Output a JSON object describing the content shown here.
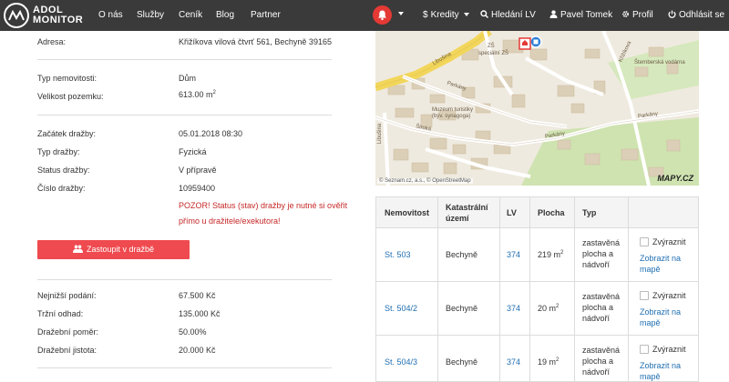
{
  "navbar": {
    "logo_line1": "ADOL",
    "logo_line2": "MONITOR",
    "links": [
      "O nás",
      "Služby",
      "Ceník",
      "Blog",
      "Partner"
    ],
    "credits": "Kredity",
    "search_lv": "Hledání LV",
    "user": "Pavel Tomek",
    "profile": "Profil",
    "logout": "Odhlásit se"
  },
  "property": {
    "address_label": "Adresa:",
    "address_value": "Křižíkova vilová čtvrť 561, Bechyně 39165",
    "type_label": "Typ nemovitosti:",
    "type_value": "Dům",
    "size_label": "Velikost pozemku:",
    "size_value": "613.00 m",
    "size_unit_sup": "2"
  },
  "auction": {
    "start_label": "Začátek dražby:",
    "start_value": "05.01.2018 08:30",
    "type_label": "Typ dražby:",
    "type_value": "Fyzická",
    "status_label": "Status dražby:",
    "status_value": "V přípravě",
    "number_label": "Číslo dražby:",
    "number_value": "10959400",
    "warning": "POZOR! Status (stav) dražby je nutné si ověřit přímo u dražitele/exekutora!",
    "represent_button": "Zastoupit v dražbě"
  },
  "prices": {
    "min_bid_label": "Nejnižší podání:",
    "min_bid_value": "67.500 Kč",
    "market_label": "Tržní odhad:",
    "market_value": "135.000 Kč",
    "ratio_label": "Dražební poměr:",
    "ratio_value": "50.00%",
    "deposit_label": "Dražební jistota:",
    "deposit_value": "20.000 Kč"
  },
  "map": {
    "attribution": "© Seznam.cz, a.s., © OpenStreetMap",
    "logo": "MAPY.CZ",
    "labels": {
      "libusina_top": "Libušina",
      "zs": "ZŠ",
      "zs_special": "speciální ZŠ",
      "krizikova": "Křižíkova",
      "sternberska": "Šternberská vodárna",
      "parkany1": "Parkány",
      "parkany2": "Parkány",
      "parkany3": "Parkány",
      "museum": "Muzeum turistiky",
      "museum_sub": "(býv. synagoga)",
      "siroka": "Široká",
      "libusina_left": "Libušina"
    }
  },
  "table": {
    "headers": [
      "Nemovitost",
      "Katastrální území",
      "LV",
      "Plocha",
      "Typ"
    ],
    "rows": [
      {
        "parcel": "St. 503",
        "area_name": "Bechyně",
        "lv": "374",
        "plocha": "219 m",
        "typ": "zastavěná plocha a nádvoří",
        "highlight": "Zvýraznit",
        "show": "Zobrazit na mapě"
      },
      {
        "parcel": "St. 504/2",
        "area_name": "Bechyně",
        "lv": "374",
        "plocha": "20 m",
        "typ": "zastavěná plocha a nádvoří",
        "highlight": "Zvýraznit",
        "show": "Zobrazit na mapě"
      },
      {
        "parcel": "St. 504/3",
        "area_name": "Bechyně",
        "lv": "374",
        "plocha": "19 m",
        "typ": "zastavěná plocha a nádvoří",
        "highlight": "Zvýraznit",
        "show": "Zobrazit na mapě"
      }
    ],
    "area_sup": "2"
  },
  "colors": {
    "navbar_bg": "#3a3a3a",
    "accent_red": "#ef4a4f",
    "link_blue": "#1f6fb2",
    "warning_red": "#c62828"
  }
}
